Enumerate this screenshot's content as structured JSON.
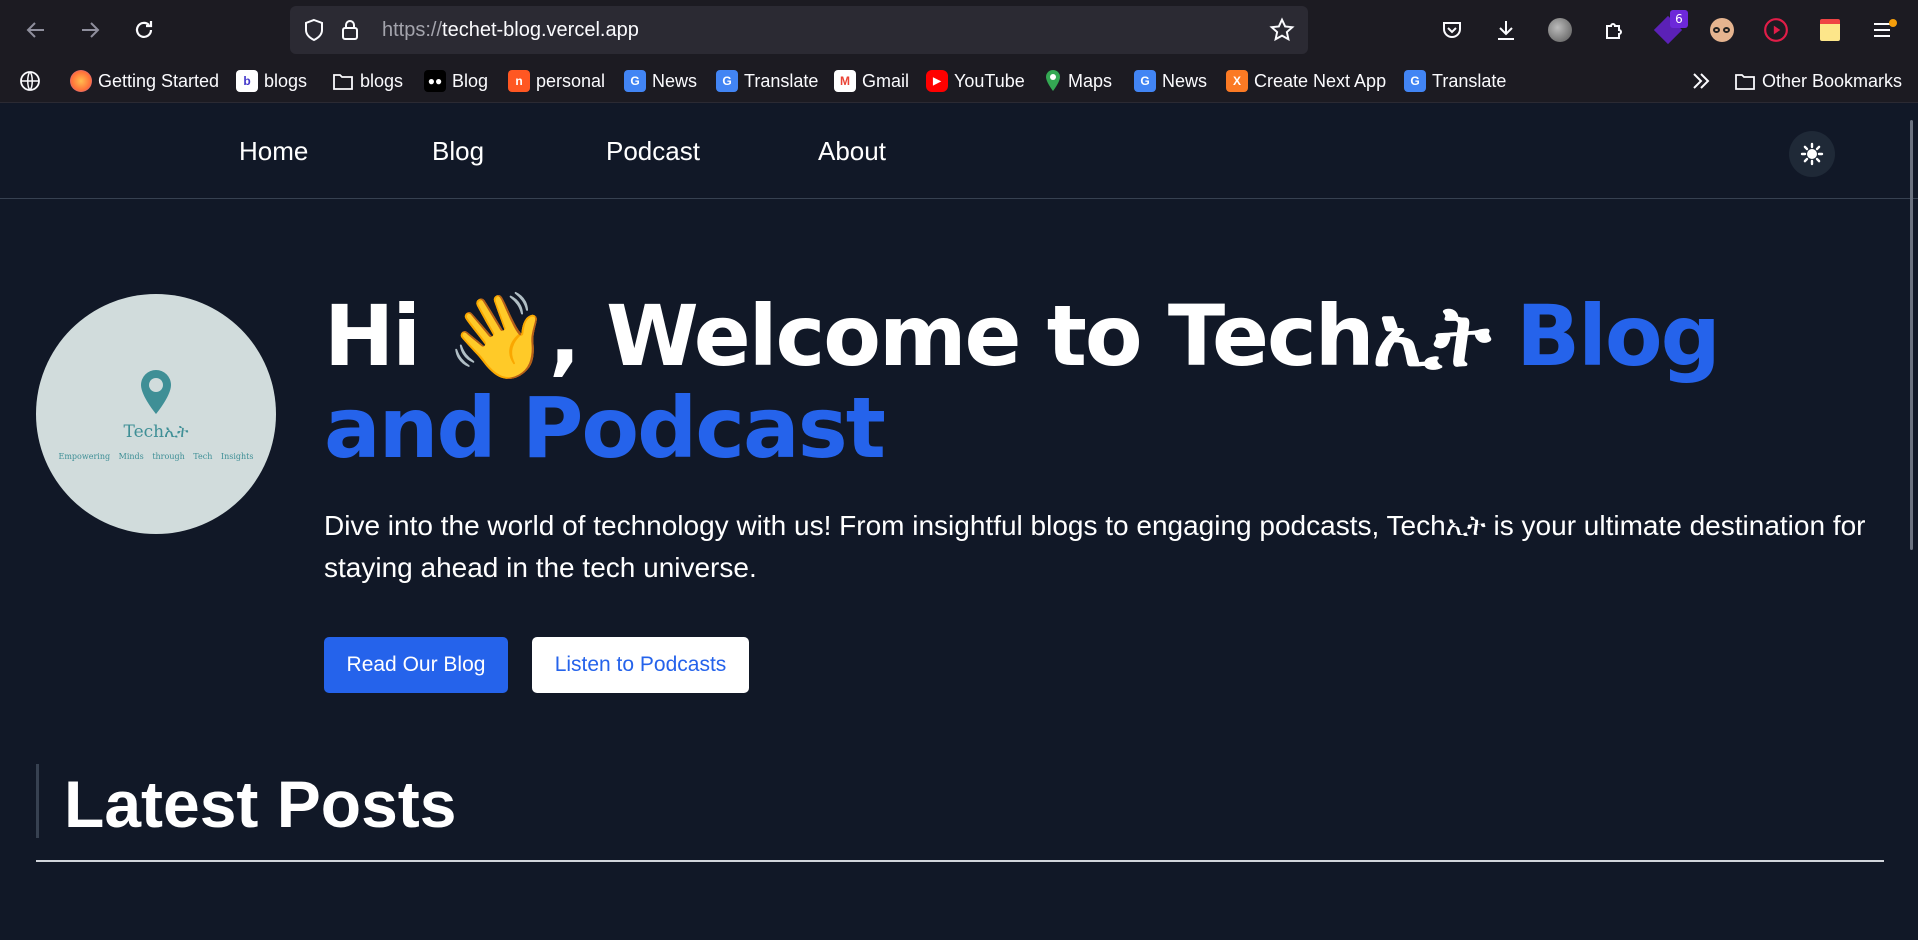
{
  "browser": {
    "url_scheme": "https://",
    "url_host": "techet-blog.vercel.app",
    "extension_badge": "6",
    "bookmarks": [
      {
        "label": "Getting Started",
        "icon": "firefox-icon",
        "color": "#ff7139"
      },
      {
        "label": "blogs",
        "icon": "blogger-icon",
        "color": "#ffffff"
      },
      {
        "label": "blogs",
        "icon": "folder-icon",
        "color": ""
      },
      {
        "label": "Blog",
        "icon": "medium-icon",
        "color": "#000000"
      },
      {
        "label": "personal",
        "icon": "n-icon",
        "color": "#ff5722"
      },
      {
        "label": "News",
        "icon": "google-news-icon",
        "color": "#4285f4"
      },
      {
        "label": "Translate",
        "icon": "google-translate-icon",
        "color": "#4285f4"
      },
      {
        "label": "Gmail",
        "icon": "gmail-icon",
        "color": "#ea4335"
      },
      {
        "label": "YouTube",
        "icon": "youtube-icon",
        "color": "#ff0000"
      },
      {
        "label": "Maps",
        "icon": "maps-pin-icon",
        "color": "#34a853"
      },
      {
        "label": "News",
        "icon": "google-news-icon",
        "color": "#4285f4"
      },
      {
        "label": "Create Next App",
        "icon": "xampp-icon",
        "color": "#fb7a24"
      },
      {
        "label": "Translate",
        "icon": "google-translate-icon",
        "color": "#4285f4"
      }
    ],
    "other_bookmarks": "Other Bookmarks"
  },
  "site": {
    "nav": [
      "Home",
      "Blog",
      "Podcast",
      "About"
    ],
    "logo": {
      "name": "Techኢት",
      "tagline": "Empowering Minds through Tech Insights"
    },
    "hero": {
      "title_white": "Hi 👋, Welcome to Techኢት ",
      "title_blue": "Blog and Podcast",
      "description": "Dive into the world of technology with us! From insightful blogs to engaging podcasts, Techኢት is your ultimate destination for staying ahead in the tech universe.",
      "primary_button": "Read Our Blog",
      "secondary_button": "Listen to Podcasts"
    },
    "latest_posts_title": "Latest Posts"
  },
  "colors": {
    "background": "#111827",
    "accent": "#2563eb",
    "browser_chrome": "#1c1b22"
  }
}
